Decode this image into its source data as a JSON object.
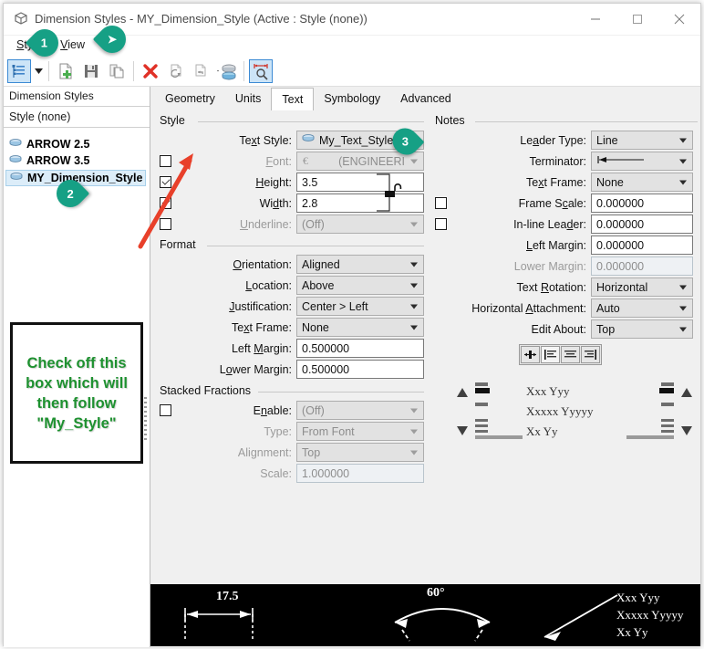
{
  "window": {
    "title": "Dimension Styles -  MY_Dimension_Style (Active : Style (none))",
    "icon": "dimension-style-icon",
    "minimize": "–",
    "maximize": "□",
    "close": "✕"
  },
  "menu": {
    "items": [
      {
        "label": "Style"
      },
      {
        "label": "View"
      }
    ]
  },
  "toolbar": {
    "buttons": [
      {
        "name": "style-list-button",
        "icon": "list-icon",
        "selected": true
      },
      {
        "name": "style-list-dropdown",
        "icon": "chevron-down-icon",
        "selected": false
      },
      {
        "name": "new-style-button",
        "icon": "new-document-icon",
        "selected": false
      },
      {
        "name": "save-style-button",
        "icon": "floppy-save-icon",
        "selected": false
      },
      {
        "name": "copy-style-button",
        "icon": "copy-icon",
        "selected": false
      },
      {
        "name": "delete-style-button",
        "icon": "red-x-delete-icon",
        "selected": false
      },
      {
        "name": "update-style-button",
        "icon": "document-refresh-icon",
        "selected": false
      },
      {
        "name": "apply-style-button",
        "icon": "document-arrow-icon",
        "selected": false
      },
      {
        "name": "import-styles-button",
        "icon": "stack-layers-icon",
        "selected": false
      },
      {
        "name": "measure-preview-button",
        "icon": "dimension-magnifier-icon",
        "selected": true
      }
    ]
  },
  "left_panel": {
    "header": "Dimension Styles",
    "subheader": "Style (none)",
    "items": [
      {
        "label": "ARROW 2.5",
        "active": false
      },
      {
        "label": "ARROW 3.5",
        "active": false
      },
      {
        "label": "MY_Dimension_Style",
        "active": true
      }
    ],
    "annotation": "Check off this box which will then follow \"My_Style\""
  },
  "tabs": [
    {
      "label": "Geometry",
      "active": false
    },
    {
      "label": "Units",
      "active": false
    },
    {
      "label": "Text",
      "active": true
    },
    {
      "label": "Symbology",
      "active": false
    },
    {
      "label": "Advanced",
      "active": false
    }
  ],
  "style_group": {
    "title": "Style",
    "rows": [
      {
        "label": "Text Style:",
        "value": "My_Text_Style",
        "control": "combo",
        "checkbox": null,
        "disabled": false,
        "icon": "text-style-icon"
      },
      {
        "label": "Font:",
        "value": "(ENGINEERI",
        "control": "combo",
        "checkbox": false,
        "disabled": true,
        "icon": "font-icon"
      },
      {
        "label": "Height:",
        "value": "3.5",
        "control": "text",
        "checkbox": true,
        "disabled": false
      },
      {
        "label": "Width:",
        "value": "2.8",
        "control": "text",
        "checkbox": true,
        "disabled": false
      },
      {
        "label": "Underline:",
        "value": "(Off)",
        "control": "combo",
        "checkbox": false,
        "disabled": true
      }
    ],
    "lock_icon": "open-padlock-icon"
  },
  "format_group": {
    "title": "Format",
    "rows": [
      {
        "label": "Orientation:",
        "value": "Aligned",
        "control": "combo",
        "disabled": false
      },
      {
        "label": "Location:",
        "value": "Above",
        "control": "combo",
        "disabled": false
      },
      {
        "label": "Justification:",
        "value": "Center > Left",
        "control": "combo",
        "disabled": false
      },
      {
        "label": "Text Frame:",
        "value": "None",
        "control": "combo",
        "disabled": false
      },
      {
        "label": "Left Margin:",
        "value": "0.500000",
        "control": "text",
        "disabled": false
      },
      {
        "label": "Lower Margin:",
        "value": "0.500000",
        "control": "text",
        "disabled": false
      }
    ]
  },
  "stacked_group": {
    "title": "Stacked Fractions",
    "rows": [
      {
        "label": "Enable:",
        "value": "(Off)",
        "control": "combo",
        "checkbox": false,
        "disabled": true
      },
      {
        "label": "Type:",
        "value": "From Font",
        "control": "combo",
        "checkbox": null,
        "disabled": true
      },
      {
        "label": "Alignment:",
        "value": "Top",
        "control": "combo",
        "checkbox": null,
        "disabled": true
      },
      {
        "label": "Scale:",
        "value": "1.000000",
        "control": "text",
        "checkbox": null,
        "disabled": true
      }
    ]
  },
  "notes_group": {
    "title": "Notes",
    "rows": [
      {
        "label": "Leader Type:",
        "value": "Line",
        "control": "combo",
        "checkbox": null,
        "disabled": false
      },
      {
        "label": "Terminator:",
        "value": "",
        "control": "combo",
        "checkbox": null,
        "disabled": false,
        "icon": "arrow-terminator-icon"
      },
      {
        "label": "Text Frame:",
        "value": "None",
        "control": "combo",
        "checkbox": null,
        "disabled": false
      },
      {
        "label": "Frame Scale:",
        "value": "0.000000",
        "control": "text",
        "checkbox": false,
        "disabled": false
      },
      {
        "label": "In-line Leader:",
        "value": "0.000000",
        "control": "text",
        "checkbox": false,
        "disabled": false
      },
      {
        "label": "Left Margin:",
        "value": "0.000000",
        "control": "text",
        "checkbox": null,
        "disabled": false
      },
      {
        "label": "Lower Margin:",
        "value": "0.000000",
        "control": "text",
        "checkbox": null,
        "disabled": true
      },
      {
        "label": "Text Rotation:",
        "value": "Horizontal",
        "control": "combo",
        "checkbox": null,
        "disabled": false
      },
      {
        "label": "Horizontal Attachment:",
        "value": "Auto",
        "control": "combo",
        "checkbox": null,
        "disabled": false
      },
      {
        "label": "Edit About:",
        "value": "Top",
        "control": "combo",
        "checkbox": null,
        "disabled": false
      }
    ],
    "alignment_buttons": [
      {
        "name": "attachment-auto-button",
        "icon": "horizontal-attach-icon",
        "selected": false
      },
      {
        "name": "align-left-button",
        "icon": "align-left-icon",
        "selected": true
      },
      {
        "name": "align-center-button",
        "icon": "align-center-icon",
        "selected": false
      },
      {
        "name": "align-right-button",
        "icon": "align-right-icon",
        "selected": false
      }
    ],
    "preview_lines": [
      "Xxx Yyy",
      "Xxxxx Yyyyy",
      "Xx Yy"
    ]
  },
  "preview_bar": {
    "linear_value": "17.5",
    "angular_value": "60°",
    "note_lines": [
      "Xxx  Yyy",
      "Xxxxx  Yyyyy",
      "Xx  Yy"
    ]
  },
  "badges": [
    {
      "id": "badge-1",
      "label": "1"
    },
    {
      "id": "badge-cursor",
      "label": "➤"
    },
    {
      "id": "badge-2",
      "label": "2"
    },
    {
      "id": "badge-3",
      "label": "3"
    }
  ],
  "colors": {
    "accent_teal": "#16a085",
    "annotation_green": "#1e9130",
    "arrow_red": "#e8402a",
    "selection_blue": "#dcedf9"
  }
}
